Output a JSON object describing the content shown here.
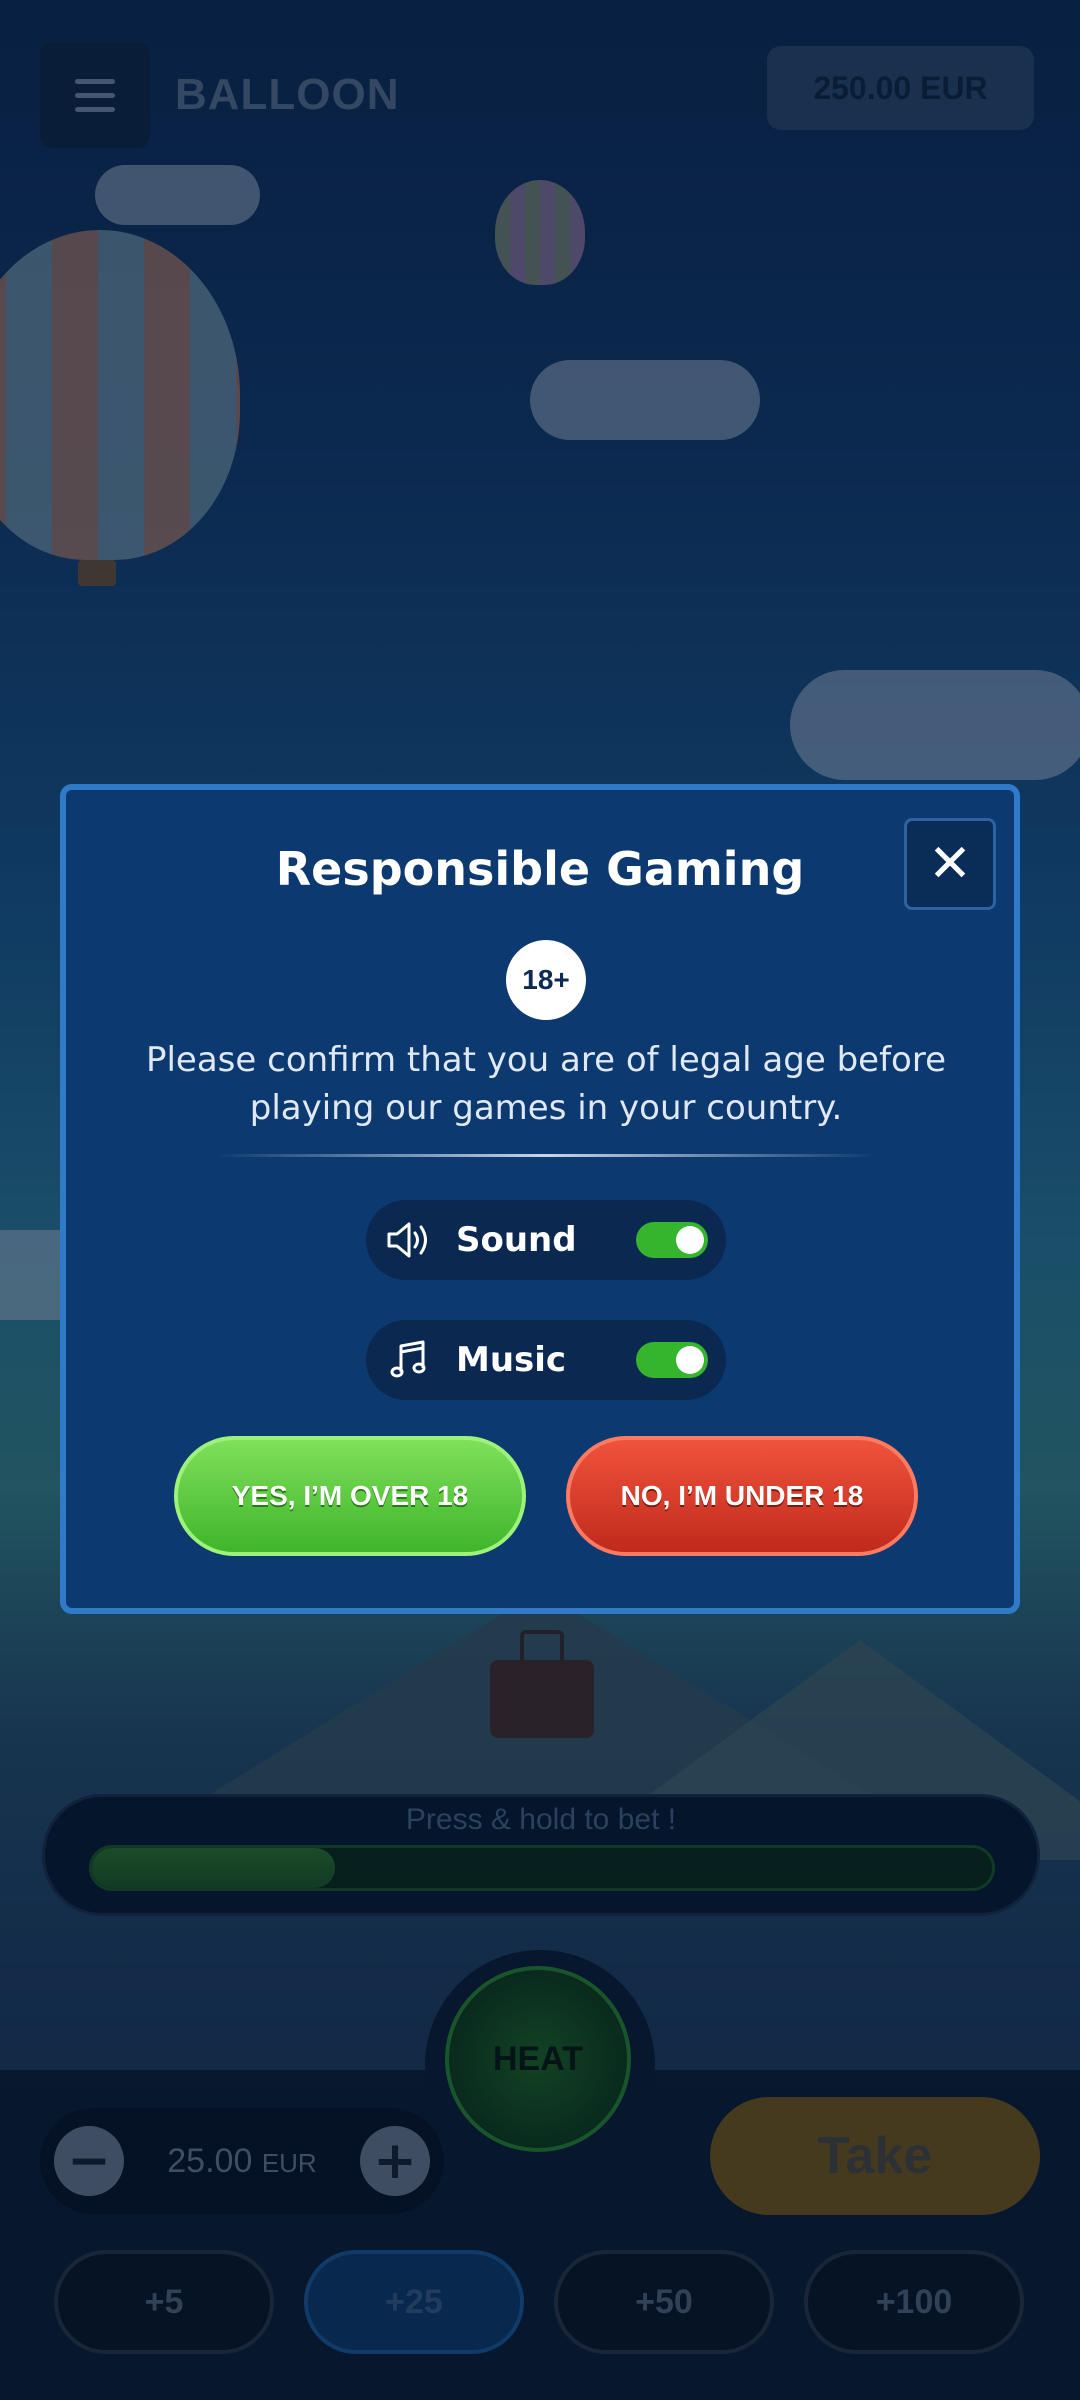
{
  "header": {
    "title": "BALLOON",
    "balance": "250.00 EUR",
    "menu_icon": "hamburger-menu-icon"
  },
  "game": {
    "bet_prompt": "Press & hold to bet !",
    "bet_progress": 0.27,
    "heat_label": "HEAT",
    "stake_value": "25.00",
    "stake_currency": "EUR",
    "minus_label": "−",
    "plus_label": "+",
    "take_label": "Take",
    "chips": [
      {
        "label": "+5",
        "active": false
      },
      {
        "label": "+25",
        "active": true
      },
      {
        "label": "+50",
        "active": false
      },
      {
        "label": "+100",
        "active": false
      }
    ]
  },
  "modal": {
    "title": "Responsible Gaming",
    "close_label": "✕",
    "age_badge": "18+",
    "message": "Please confirm that you are of legal age before playing our games in your country.",
    "sound": {
      "label": "Sound",
      "enabled": true,
      "icon": "speaker-icon"
    },
    "music": {
      "label": "Music",
      "enabled": true,
      "icon": "music-note-icon"
    },
    "yes_label": "YES,  I’M OVER 18",
    "no_label": "NO, I’M UNDER 18",
    "colors": {
      "yes": "#4fc434",
      "no": "#d83a26",
      "toggle_on": "#35b52e"
    }
  }
}
